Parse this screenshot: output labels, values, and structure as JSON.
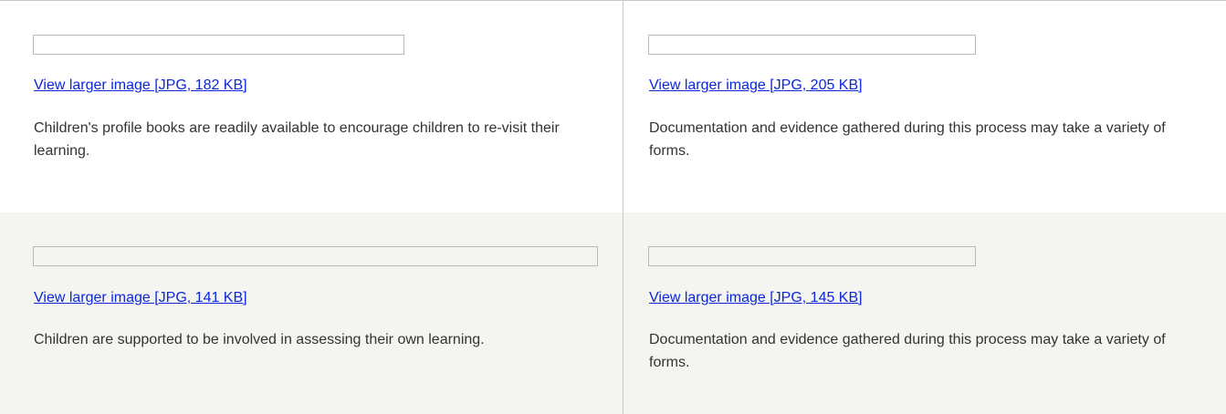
{
  "gallery": {
    "items": [
      {
        "link": "View larger image [JPG, 182 KB]",
        "caption": "Children's profile books are readily available to encourage children to re-visit their learning."
      },
      {
        "link": "View larger image [JPG, 205 KB]",
        "caption": "Documentation and evidence gathered during this process may take a variety of forms."
      },
      {
        "link": "View larger image [JPG, 141 KB]",
        "caption": "Children are supported to be involved in assessing their own learning."
      },
      {
        "link": "View larger image [JPG, 145 KB]",
        "caption": "Documentation and evidence gathered during this process may take a variety of forms."
      }
    ]
  },
  "colors": {
    "link": "#0b27dd",
    "text": "#333333",
    "alt_row_background": "#f4f4f0",
    "border": "#c9c9c9"
  }
}
